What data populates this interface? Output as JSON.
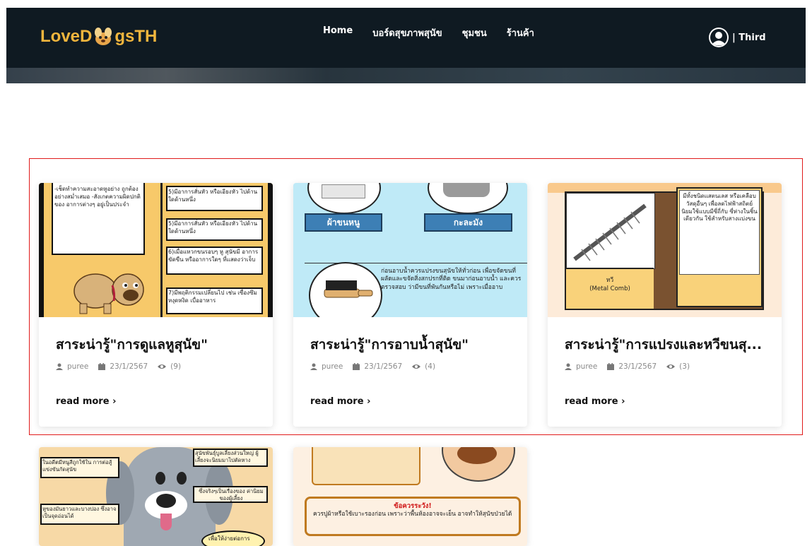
{
  "header": {
    "logo_left": "LoveD",
    "logo_right": "gsTH",
    "nav": [
      "Home",
      "บอร์ดสุขภาพสุนัข",
      "ชุมชน",
      "ร้านค้า"
    ],
    "user": "| Third"
  },
  "cards": [
    {
      "title": "สาระน่ารู้\"การดูแลหูสุนัข\"",
      "author": "puree",
      "date": "23/1/2567",
      "views": "(9)",
      "readmore": "read more ›",
      "thumb_left": "-เช็ดทำความสะอาดหูอย่าง ถูกต้องอย่างสม่ำเสมอ -สังเกตความผิดปกติของ อาการต่างๆ อยู่เป็นประจำ",
      "thumb_items": [
        "5)มีอาการสั่นหัว หรือเอียงหัว ไปด้านใดด้านหนึ่ง",
        "5)มีอาการสั่นหัว หรือเอียงหัว ไปด้านใดด้านหนึ่ง",
        "6)เมื่อแหวกขนรอบๆ หู สุนัขมี อาการขัดขืน หรืออาการใดๆ ที่แสดงว่าเจ็บ",
        "7)มีพฤติกรรมเปลี่ยนไป เช่น เซื่องซึม หงุดหงิด เบื่ออาหาร"
      ]
    },
    {
      "title": "สาระน่ารู้\"การอาบน้ำสุนัข\"",
      "author": "puree",
      "date": "23/1/2567",
      "views": "(4)",
      "readmore": "read more ›",
      "thumb_btn1": "ผ้าขนหนู",
      "thumb_btn2": "กะละมัง",
      "thumb_text": "ก่อนอาบน้ำควรแปรงขนสุนัขให้ทั่วก่อน เพื่อขจัดขนที่ผลัดและขจัดสิ่งสกปรกที่ติด ขนมาก่อนอาบน้ำ และควรตรวจสอบ ว่ามีขนที่พันกันหรือไม่ เพราะเมื่ออาบ"
    },
    {
      "title": "สาระน่ารู้\"การแปรงและหวีขนสุ...",
      "author": "puree",
      "date": "23/1/2567",
      "views": "(3)",
      "readmore": "read more ›",
      "thumb_label1": "หวี",
      "thumb_label2": "(Metal Comb)",
      "thumb_text": "มีทั้งชนิดแสตนเลส หรือเคลือบวัสดุอื่นๆ เพื่อลดไฟฟ้าสถิตย์ นิยมใช้แบบมีซี่ถี่กับ ซี่ห่างในชิ้นเดียวกัน ใช้สำหรับสางแบ่งขน"
    }
  ],
  "bottom_cards": [
    {
      "text1": "ในอดีตมีหนูสีถูกใช้ใน การต่อสู้แข่งขันกัดสุนัข",
      "text2": "สุนัขพันธุ์บูลเลี้ยงส่วนใหญ่ ผู้เลี้ยงจะนิยมมาไปตัดหาง",
      "text3": "ซึ่งจริงๆเป็นเรื่องของ ค่านิยมของผู้เลี้ยง",
      "text4": "หูของมันยาวและบางปอง ซึ่งอาจเป็นจุดอ่อนได้",
      "text5": "เพื่อให้ง่ายต่อการ"
    },
    {
      "warn_title": "ข้อควรระวัง!",
      "warn_text": "ควรปูผ้าหรือใช้เบาะรองก่อน เพราะว่าพื้นห้องอาจจะเย็น อาจทำให้สุนัขป่วยได้"
    }
  ],
  "colors": {
    "nav_bg": "#0f1a22",
    "logo": "#f0b53d",
    "highlight": "#e01b1b",
    "card1_bg": "#f7c96a",
    "card2_bg": "#bfeaf7",
    "card3_bg": "#fdebd9"
  }
}
